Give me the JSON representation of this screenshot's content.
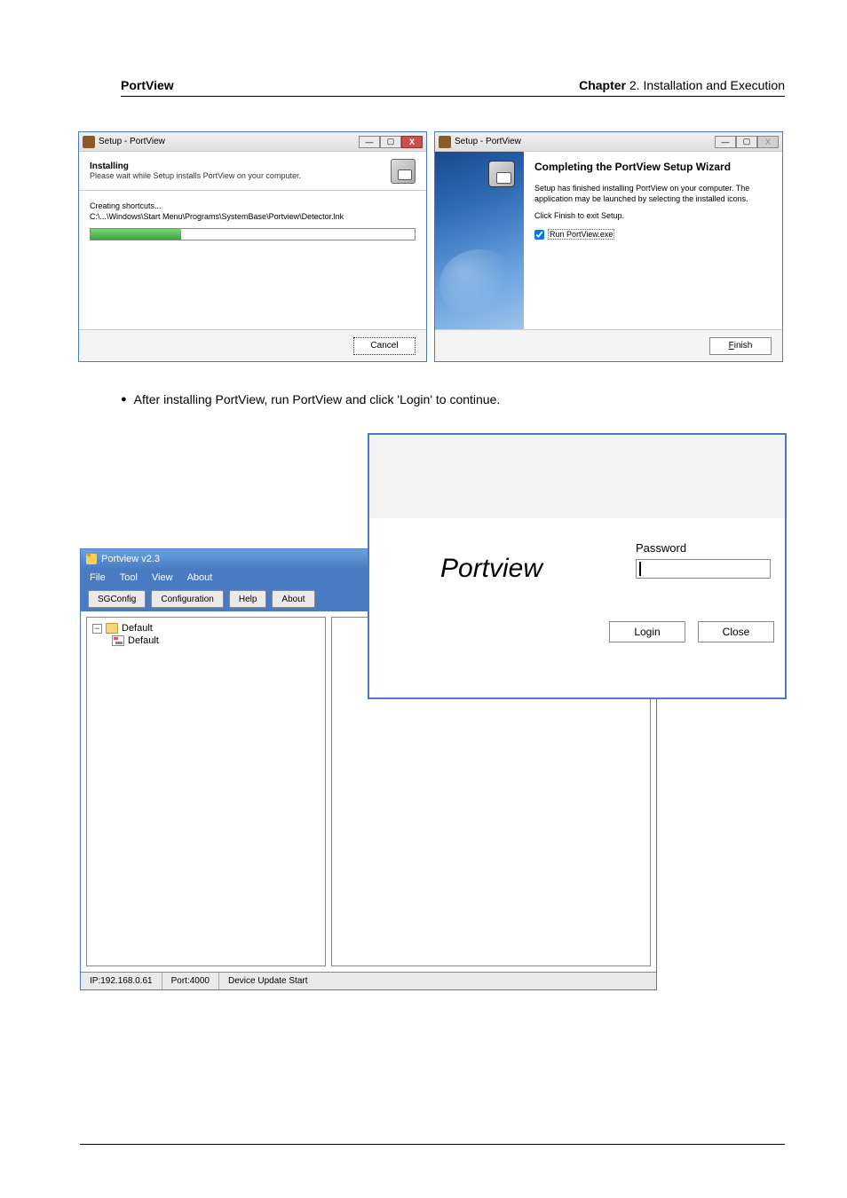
{
  "header": {
    "left": "PortView",
    "chapter_bold": "Chapter",
    "chapter_rest": " 2. Installation and Execution"
  },
  "dlg_install": {
    "title": "Setup - PortView",
    "h1": "Installing",
    "h2": "Please wait while Setup installs PortView on your computer.",
    "p1": "Creating shortcuts...",
    "p2": "C:\\...\\Windows\\Start Menu\\Programs\\SystemBase\\Portview\\Detector.lnk",
    "cancel": "Cancel"
  },
  "dlg_complete": {
    "title": "Setup - PortView",
    "h1": "Completing the PortView Setup Wizard",
    "p1": "Setup has finished installing PortView on your computer. The application may be launched by selecting the installed icons.",
    "p2": "Click Finish to exit Setup.",
    "chk": "Run PortView.exe",
    "finish": "Finish"
  },
  "bullet": "After installing PortView, run PortView and click 'Login' to continue.",
  "pv_app": {
    "title": "Portview v2.3",
    "menu": {
      "file": "File",
      "tool": "Tool",
      "view": "View",
      "about": "About"
    },
    "toolbar": {
      "sgconfig": "SGConfig",
      "configuration": "Configuration",
      "help": "Help",
      "about": "About"
    },
    "tree": {
      "root": "Default",
      "child": "Default"
    },
    "status": {
      "ip": "IP:192.168.0.61",
      "port": "Port:4000",
      "upd": "Device Update Start"
    }
  },
  "login": {
    "brand": "Portview",
    "password": "Password",
    "login": "Login",
    "close": "Close"
  }
}
